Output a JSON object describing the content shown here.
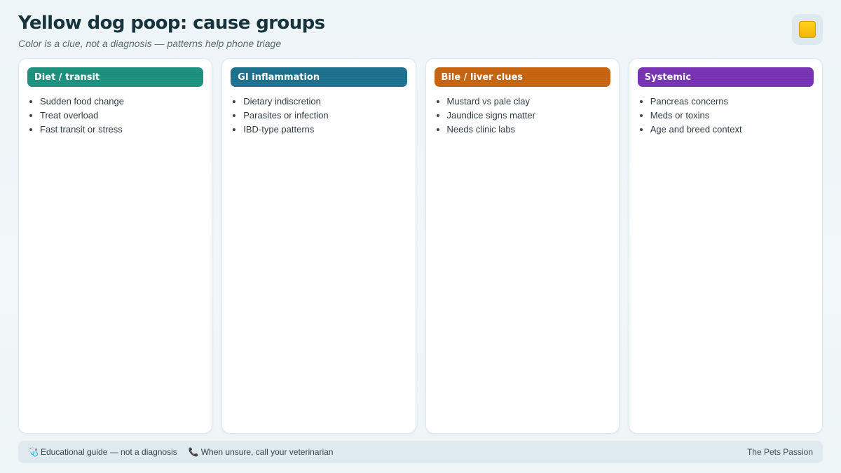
{
  "header": {
    "title": "Yellow dog poop: cause groups",
    "subtitle": "Color is a clue, not a diagnosis — patterns help phone triage"
  },
  "badge": {
    "icon": "yellow-square-icon",
    "color": "#f5b800"
  },
  "cards": [
    {
      "title": "Diet / transit",
      "color": "#1a8f7c",
      "items": [
        "Sudden food change",
        "Treat overload",
        "Fast transit or stress"
      ]
    },
    {
      "title": "GI inflammation",
      "color": "#1a6f8c",
      "items": [
        "Dietary indiscretion",
        "Parasites or infection",
        "IBD-type patterns"
      ]
    },
    {
      "title": "Bile / liver clues",
      "color": "#c5620e",
      "items": [
        "Mustard vs pale clay",
        "Jaundice signs matter",
        "Needs clinic labs"
      ]
    },
    {
      "title": "Systemic",
      "color": "#7430b0",
      "items": [
        "Pancreas concerns",
        "Meds or toxins",
        "Age and breed context"
      ]
    }
  ],
  "footer": {
    "items": [
      {
        "icon": "stethoscope-icon",
        "glyph": "🩺",
        "text": "Educational guide — not a diagnosis"
      },
      {
        "icon": "phone-icon",
        "glyph": "📞",
        "text": "When unsure, call your veterinarian"
      }
    ],
    "brand": "The Pets Passion"
  }
}
